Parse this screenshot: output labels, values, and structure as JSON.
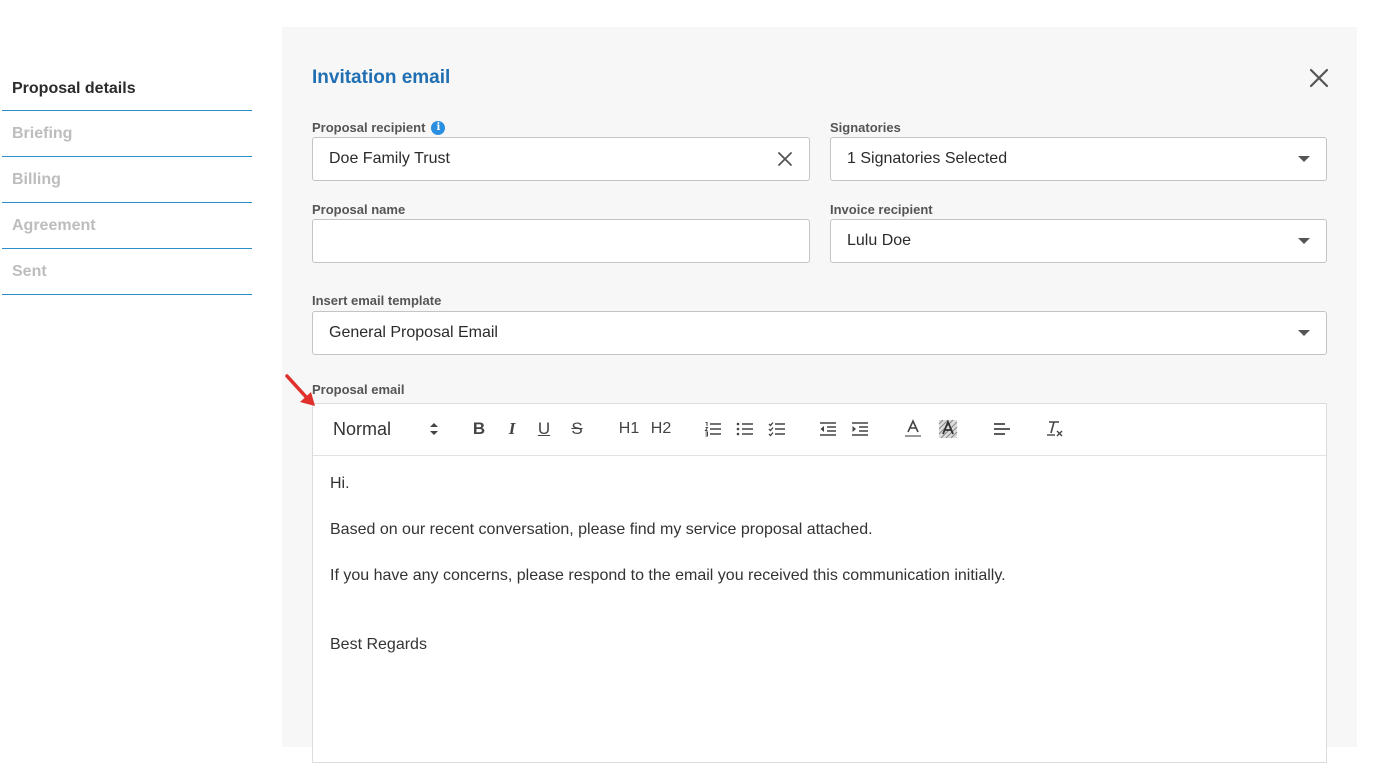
{
  "steps": [
    {
      "label": "Proposal details",
      "active": true
    },
    {
      "label": "Briefing",
      "active": false
    },
    {
      "label": "Billing",
      "active": false
    },
    {
      "label": "Agreement",
      "active": false
    },
    {
      "label": "Sent",
      "active": false
    }
  ],
  "panel": {
    "title": "Invitation email",
    "proposal_recipient": {
      "label": "Proposal recipient",
      "value": "Doe Family Trust",
      "info": "i"
    },
    "signatories": {
      "label": "Signatories",
      "value": "1 Signatories Selected"
    },
    "proposal_name": {
      "label": "Proposal name",
      "value": "",
      "placeholder": ""
    },
    "invoice_recipient": {
      "label": "Invoice recipient",
      "value": "Lulu Doe"
    },
    "email_template": {
      "label": "Insert email template",
      "value": "General Proposal Email"
    },
    "proposal_email": {
      "label": "Proposal email",
      "format": "Normal",
      "toolbar": [
        "bold-icon",
        "italic-icon",
        "underline-icon",
        "strikethrough-icon",
        "heading-1-icon",
        "heading-2-icon",
        "ordered-list-icon",
        "bullet-list-icon",
        "checklist-icon",
        "outdent-icon",
        "indent-icon",
        "text-color-icon",
        "highlight-color-icon",
        "align-left-icon",
        "clear-format-icon"
      ],
      "h1": "H1",
      "h2": "H2",
      "bold": "B",
      "italic": "I",
      "underline": "U",
      "strike": "S",
      "body": [
        "Hi.",
        "Based on our recent conversation, please find my service proposal attached.",
        "If you have any concerns, please respond to the email you received this communication initially.",
        "Best Regards"
      ]
    }
  },
  "colors": {
    "accent": "#1f6fb2",
    "divider": "#2a8fc9",
    "arrow": "#e0302b"
  }
}
